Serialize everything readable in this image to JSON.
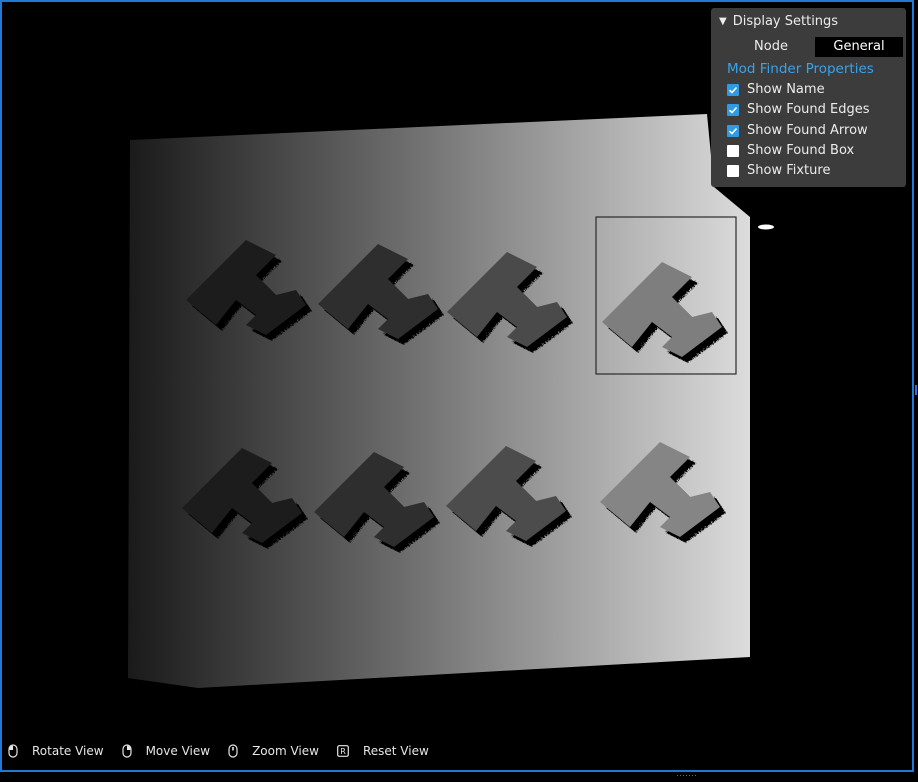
{
  "display_settings": {
    "title": "Display Settings",
    "tabs": [
      {
        "label": "Node",
        "active": false
      },
      {
        "label": "General",
        "active": true
      }
    ],
    "section_title": "Mod Finder Properties",
    "options": [
      {
        "label": "Show Name",
        "checked": true
      },
      {
        "label": "Show Found Edges",
        "checked": true
      },
      {
        "label": "Show Found Arrow",
        "checked": true
      },
      {
        "label": "Show Found Box",
        "checked": false
      },
      {
        "label": "Show Fixture",
        "checked": false
      }
    ]
  },
  "footer": {
    "hints": [
      {
        "icon": "mouse-left-icon",
        "label": "Rotate View"
      },
      {
        "icon": "mouse-right-icon",
        "label": "Move View"
      },
      {
        "icon": "mouse-wheel-icon",
        "label": "Zoom View"
      },
      {
        "icon": "r-key-icon",
        "key": "R",
        "label": "Reset View"
      }
    ]
  },
  "colors": {
    "accent": "#2f9be6",
    "border": "#1e7ad6",
    "panel": "#3c3c3c",
    "section_title": "#3aa2ea"
  }
}
